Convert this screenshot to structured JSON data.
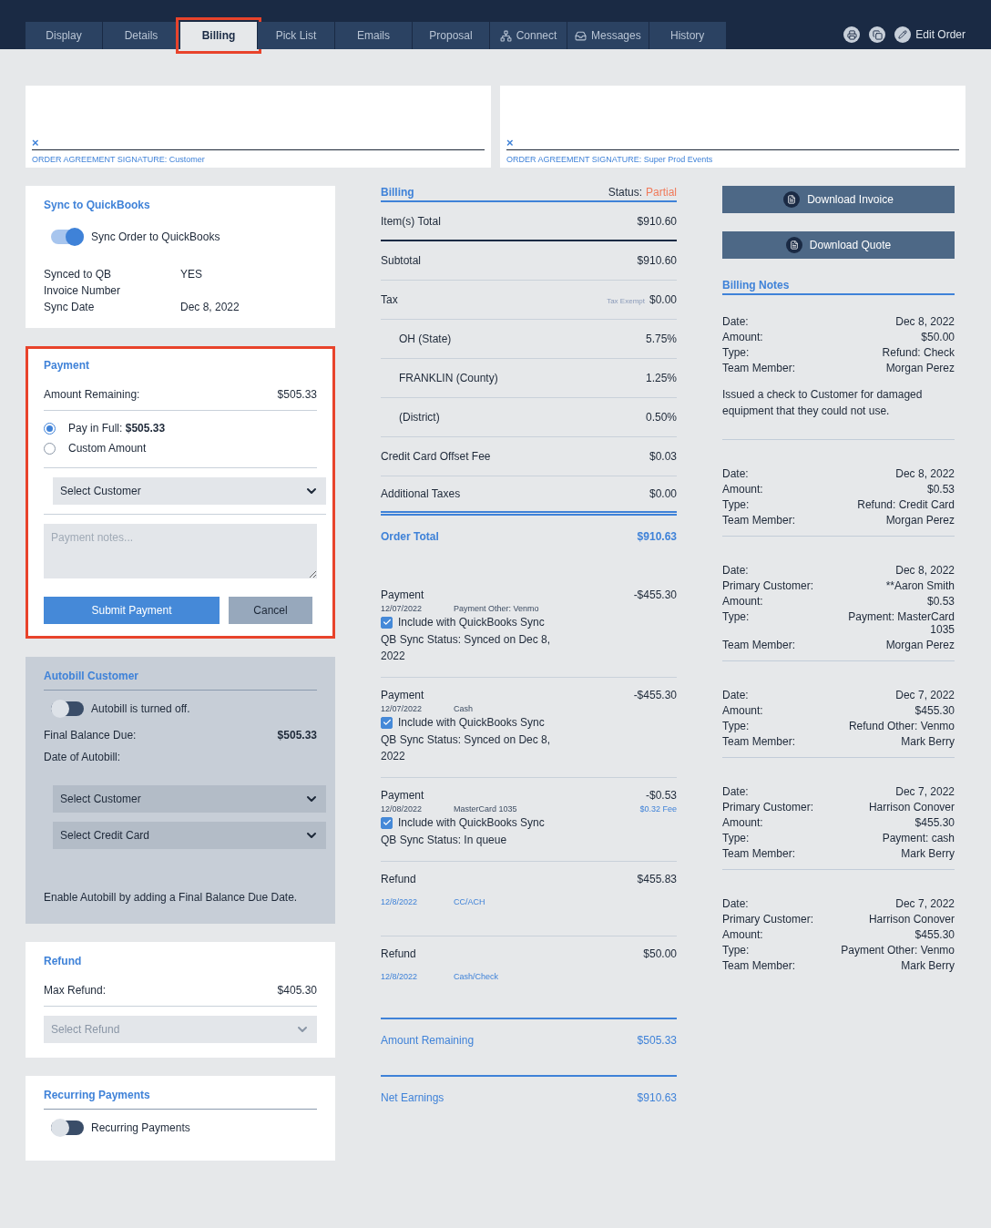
{
  "nav": {
    "tabs": [
      {
        "label": "Display",
        "selected": false,
        "highlighted": false
      },
      {
        "label": "Details",
        "selected": false,
        "highlighted": false
      },
      {
        "label": "Billing",
        "selected": true,
        "highlighted": true
      },
      {
        "label": "Pick List",
        "selected": false,
        "highlighted": false
      },
      {
        "label": "Emails",
        "selected": false,
        "highlighted": false
      },
      {
        "label": "Proposal",
        "selected": false,
        "highlighted": false
      },
      {
        "label": "Connect",
        "selected": false,
        "highlighted": false,
        "kind": "network"
      },
      {
        "label": "Messages",
        "selected": false,
        "highlighted": false,
        "kind": "inbox"
      },
      {
        "label": "History",
        "selected": false,
        "highlighted": false
      }
    ],
    "edit_label": "Edit Order"
  },
  "signatures": [
    {
      "clear": "×",
      "caption": "ORDER AGREEMENT SIGNATURE: Customer"
    },
    {
      "clear": "×",
      "caption": "ORDER AGREEMENT SIGNATURE: Super Prod Events"
    }
  ],
  "sync": {
    "title": "Sync to QuickBooks",
    "toggle": {
      "label": "Sync Order to QuickBooks",
      "on": true
    },
    "facts": [
      {
        "label": "Synced to QB",
        "value": "YES"
      },
      {
        "label": "Invoice Number"
      },
      {
        "label": "Sync Date",
        "value": "Dec 8, 2022"
      }
    ]
  },
  "payment": {
    "title": "Payment",
    "highlighted": true,
    "amount_label": "Amount Remaining:",
    "amount": "$505.33",
    "options": [
      {
        "label": "Pay in Full: **$505.33**",
        "selected": true
      },
      {
        "label": "Custom Amount",
        "selected": false
      }
    ],
    "customer_select": "Select Customer",
    "notes_placeholder": "Payment notes...",
    "submit": "Submit Payment",
    "cancel": "Cancel"
  },
  "autobill": {
    "title": "Autobill Customer",
    "toggle": {
      "label": "Autobill is turned off.",
      "on": false
    },
    "final_label": "Final Balance Due:",
    "final_value": "$505.33",
    "date_label": "Date of Autobill:",
    "selects": [
      "Select Customer",
      "Select Credit Card"
    ],
    "hint": "Enable Autobill by adding a Final Balance Due Date."
  },
  "refund": {
    "title": "Refund",
    "max_label": "Max Refund:",
    "max_value": "$405.30",
    "select_placeholder": "Select Refund"
  },
  "recurring": {
    "title": "Recurring Payments",
    "toggle": {
      "label": "Recurring Payments",
      "on": false
    }
  },
  "billing": {
    "title": "Billing",
    "status_label": "Status:",
    "status": "Partial",
    "lines": [
      {
        "kind": "total",
        "label": "Item(s) Total",
        "value": "$910.60"
      },
      {
        "kind": "line",
        "label": "Subtotal",
        "value": "$910.60"
      },
      {
        "kind": "line",
        "label": "Tax",
        "note": "Tax Exempt",
        "value": "$0.00"
      },
      {
        "kind": "sub",
        "label": "OH (State)",
        "value": "5.75%"
      },
      {
        "kind": "sub",
        "label": "FRANKLIN (County)",
        "value": "1.25%"
      },
      {
        "kind": "sub",
        "label": "(District)",
        "value": "0.50%"
      },
      {
        "kind": "line",
        "label": "Credit Card Offset Fee",
        "value": "$0.03"
      },
      {
        "kind": "last",
        "label": "Additional Taxes",
        "value": "$0.00"
      }
    ],
    "order_total": {
      "label": "Order Total",
      "value": "$910.63"
    },
    "transactions": [
      {
        "kind": "payment",
        "title": "Payment",
        "amount": "-$455.30",
        "date": "12/07/2022",
        "method": "Payment Other: Venmo",
        "sync_label": "Include with QuickBooks Sync",
        "checked": true,
        "sync_status": "QB Sync Status: Synced on Dec 8, 2022"
      },
      {
        "kind": "payment",
        "title": "Payment",
        "amount": "-$455.30",
        "date": "12/07/2022",
        "method": "Cash",
        "sync_label": "Include with QuickBooks Sync",
        "checked": true,
        "sync_status": "QB Sync Status: Synced on Dec 8, 2022"
      },
      {
        "kind": "payment",
        "title": "Payment",
        "amount": "-$0.53",
        "fee": "$0.32 Fee",
        "date": "12/08/2022",
        "method": "MasterCard 1035",
        "sync_label": "Include with QuickBooks Sync",
        "checked": true,
        "sync_status": "QB Sync Status: In queue"
      },
      {
        "kind": "refund",
        "title": "Refund",
        "amount": "$455.83",
        "date": "12/8/2022",
        "method": "CC/ACH"
      },
      {
        "kind": "refund",
        "title": "Refund",
        "amount": "$50.00",
        "date": "12/8/2022",
        "method": "Cash/Check"
      }
    ],
    "summary": [
      {
        "label": "Amount Remaining",
        "value": "$505.33"
      },
      {
        "label": "Net Earnings",
        "value": "$910.63"
      }
    ]
  },
  "downloads": [
    "Download Invoice",
    "Download Quote"
  ],
  "notes": {
    "title": "Billing Notes",
    "entries": [
      {
        "fields": [
          {
            "label": "Date:",
            "value": "Dec 8, 2022"
          },
          {
            "label": "Amount:",
            "value": "$50.00"
          },
          {
            "label": "Type:",
            "value": "Refund: Check"
          },
          {
            "label": "Team Member:",
            "value": "Morgan Perez"
          }
        ],
        "comment": "Issued a check to Customer for damaged equipment that they could not use."
      },
      {
        "fields": [
          {
            "label": "Date:",
            "value": "Dec 8, 2022"
          },
          {
            "label": "Amount:",
            "value": "$0.53"
          },
          {
            "label": "Type:",
            "value": "Refund: Credit Card"
          },
          {
            "label": "Team Member:",
            "value": "Morgan Perez"
          }
        ]
      },
      {
        "fields": [
          {
            "label": "Date:",
            "value": "Dec 8, 2022"
          },
          {
            "label": "Primary Customer:",
            "value": "**Aaron Smith"
          },
          {
            "label": "Amount:",
            "value": "$0.53"
          },
          {
            "label": "Type:",
            "value": "Payment: MasterCard 1035"
          },
          {
            "label": "Team Member:",
            "value": "Morgan Perez"
          }
        ]
      },
      {
        "fields": [
          {
            "label": "Date:",
            "value": "Dec 7, 2022"
          },
          {
            "label": "Amount:",
            "value": "$455.30"
          },
          {
            "label": "Type:",
            "value": "Refund Other: Venmo"
          },
          {
            "label": "Team Member:",
            "value": "Mark Berry"
          }
        ]
      },
      {
        "fields": [
          {
            "label": "Date:",
            "value": "Dec 7, 2022"
          },
          {
            "label": "Primary Customer:",
            "value": "Harrison Conover"
          },
          {
            "label": "Amount:",
            "value": "$455.30"
          },
          {
            "label": "Type:",
            "value": "Payment: cash"
          },
          {
            "label": "Team Member:",
            "value": "Mark Berry"
          }
        ]
      },
      {
        "fields": [
          {
            "label": "Date:",
            "value": "Dec 7, 2022"
          },
          {
            "label": "Primary Customer:",
            "value": "Harrison Conover"
          },
          {
            "label": "Amount:",
            "value": "$455.30"
          },
          {
            "label": "Type:",
            "value": "Payment Other: Venmo"
          },
          {
            "label": "Team Member:",
            "value": "Mark Berry"
          }
        ]
      }
    ]
  }
}
